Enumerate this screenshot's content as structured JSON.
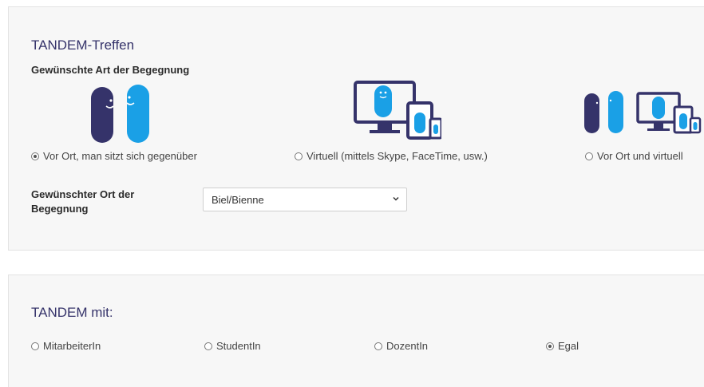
{
  "meeting": {
    "title": "TANDEM-Treffen",
    "type_label": "Gewünschte Art der Begegnung",
    "options": [
      {
        "label": "Vor Ort, man sitzt sich gegenüber",
        "checked": true
      },
      {
        "label": "Virtuell (mittels Skype, FaceTime, usw.)",
        "checked": false
      },
      {
        "label": "Vor Ort und virtuell",
        "checked": false
      }
    ],
    "location_label_line1": "Gewünschter Ort der",
    "location_label_line2": "Begegnung",
    "location_value": "Biel/Bienne"
  },
  "partner": {
    "title": "TANDEM mit:",
    "options": [
      {
        "label": "MitarbeiterIn",
        "checked": false
      },
      {
        "label": "StudentIn",
        "checked": false
      },
      {
        "label": "DozentIn",
        "checked": false
      },
      {
        "label": "Egal",
        "checked": true
      }
    ]
  },
  "colors": {
    "dark_purple": "#35336a",
    "light_blue": "#1aa0e6"
  }
}
